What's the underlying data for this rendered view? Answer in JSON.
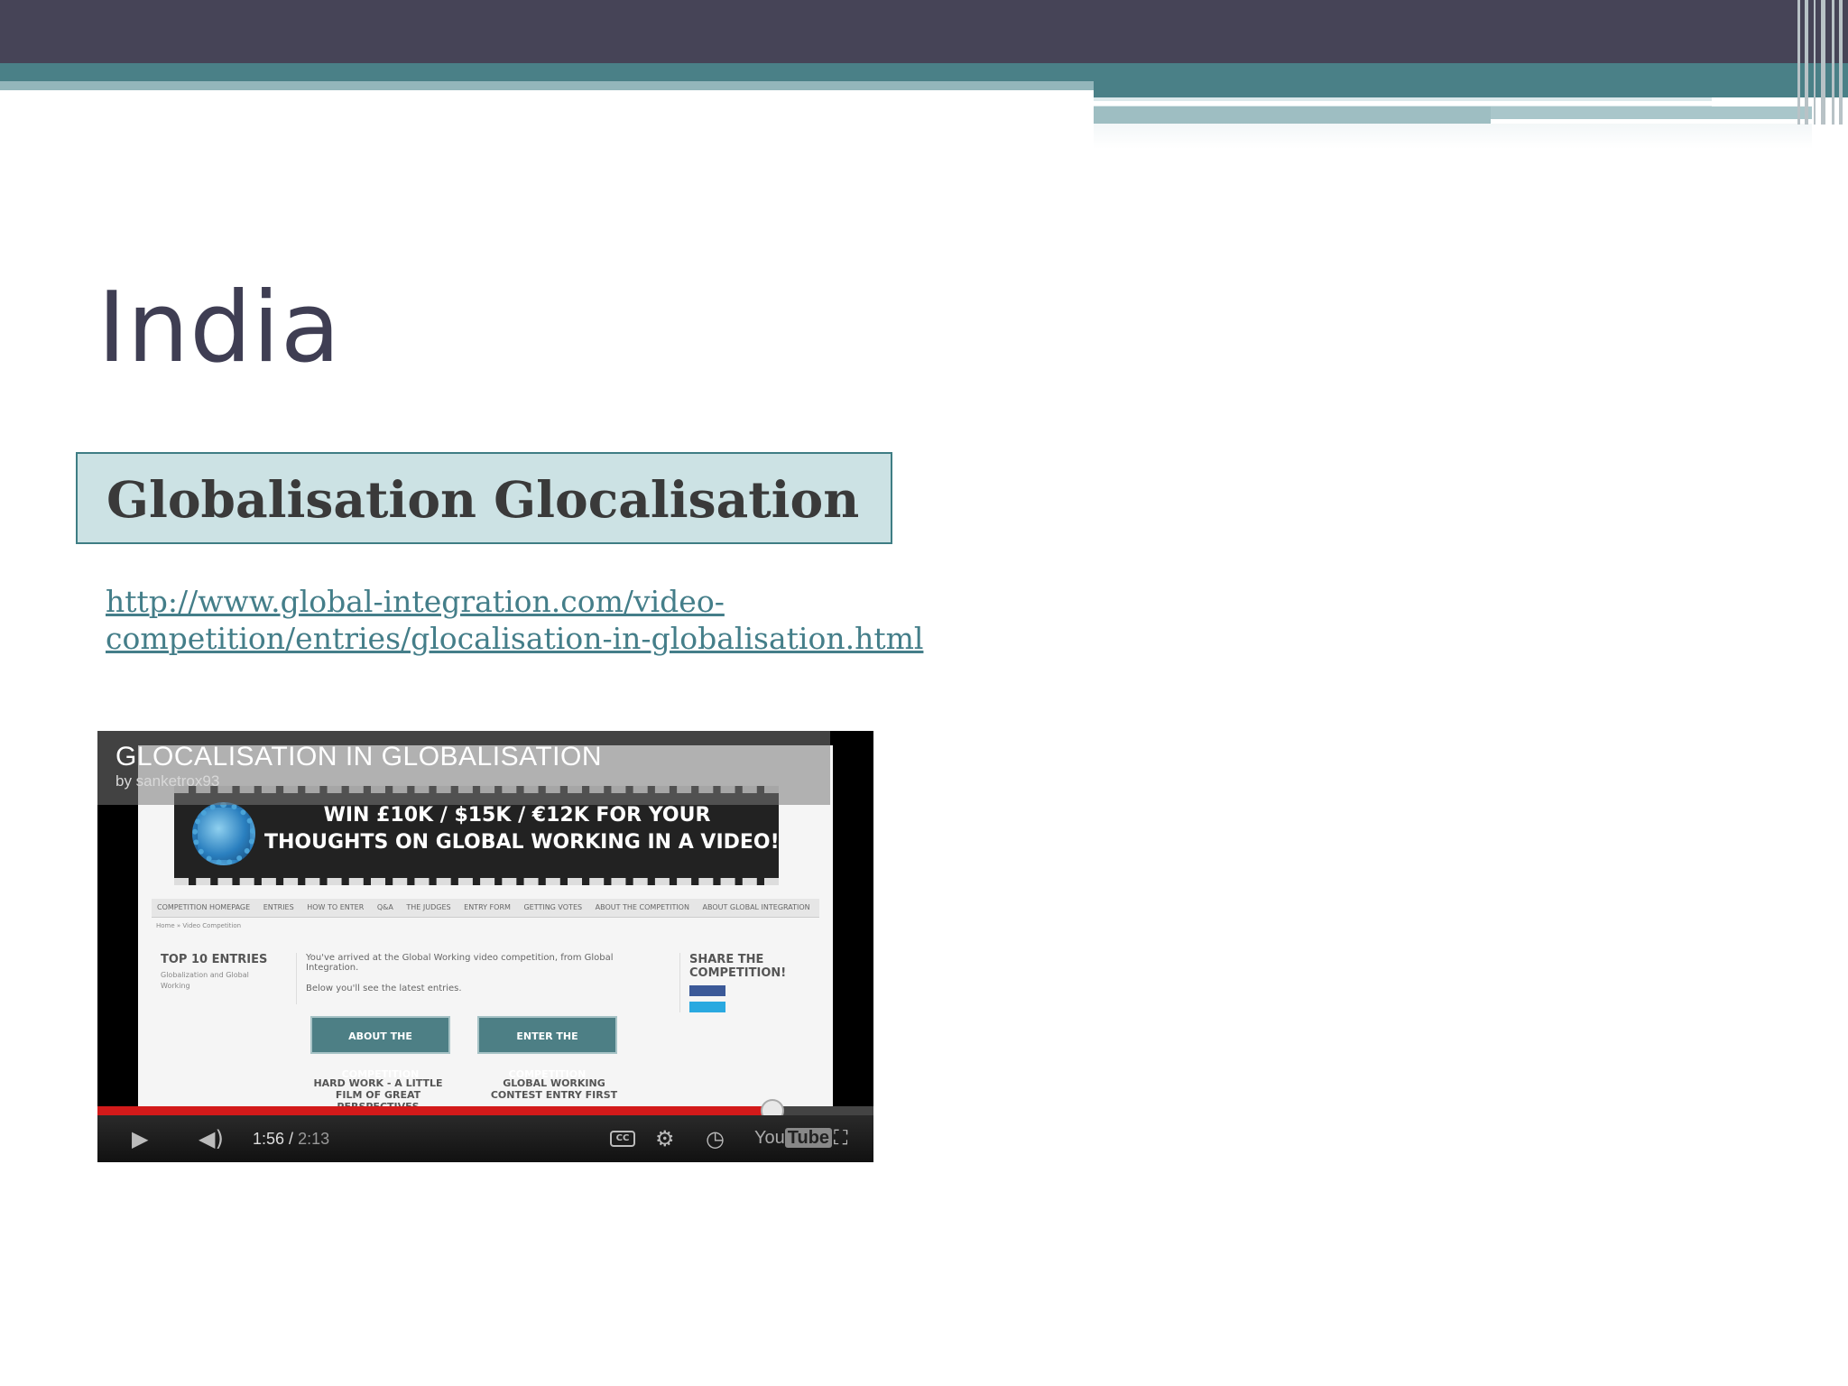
{
  "slide": {
    "title": "India",
    "subtitle": "Globalisation Glocalisation",
    "link_line1": "http://www.global-integration.com/video-",
    "link_line2": "competition/entries/glocalisation-in-globalisation.html"
  },
  "video": {
    "title": "GLOCALISATION IN GLOBALISATION",
    "byline": "by sanketrox93",
    "banner_line1": "WIN £10K / $15K / €12K FOR YOUR",
    "banner_line2": "THOUGHTS ON GLOBAL WORKING IN A VIDEO!",
    "nav": [
      "COMPETITION HOMEPAGE",
      "ENTRIES",
      "HOW TO ENTER",
      "Q&A",
      "THE JUDGES",
      "ENTRY FORM",
      "GETTING VOTES",
      "ABOUT THE COMPETITION",
      "ABOUT GLOBAL INTEGRATION"
    ],
    "breadcrumb": "Home » Video Competition",
    "top_entries_heading": "TOP 10 ENTRIES",
    "top_entries_text": "Globalization and Global Working",
    "intro_text": "You've arrived at the Global Working video competition, from Global Integration.",
    "intro_text2": "Below you'll see the latest entries.",
    "about_button": "ABOUT THE COMPETITION",
    "enter_button": "ENTER THE COMPETITION",
    "post_a": "HARD WORK - A LITTLE FILM OF GREAT PERSPECTIVES",
    "post_b": "GLOBAL WORKING CONTEST ENTRY FIRST",
    "share_heading": "SHARE THE COMPETITION!",
    "current_time": "1:56",
    "duration": "2:13",
    "progress_fraction": 0.87,
    "cc_label": "CC",
    "youtube_label_a": "You",
    "youtube_label_b": "Tube"
  },
  "colors": {
    "header_dark": "#464457",
    "header_teal": "#4a8087",
    "title_text": "#3f3e53",
    "subtitle_box": "#cce2e4",
    "link": "#447e89"
  }
}
